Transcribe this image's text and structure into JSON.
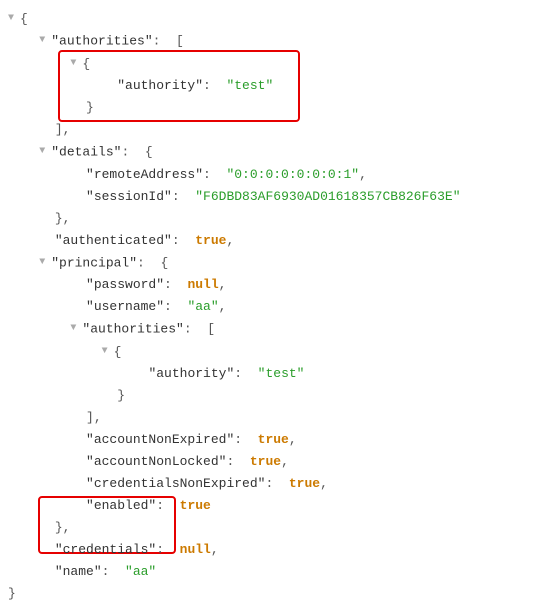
{
  "lines": {
    "l0": "{",
    "k1": "\"authorities\"",
    "v1": "[",
    "l2": "{",
    "k3": "\"authority\"",
    "v3": "\"test\"",
    "l4": "}",
    "l5": "],",
    "k6": "\"details\"",
    "v6": "{",
    "k7": "\"remoteAddress\"",
    "v7": "\"0:0:0:0:0:0:0:1\"",
    "k8": "\"sessionId\"",
    "v8": "\"F6DBD83AF6930AD01618357CB826F63E\"",
    "l9": "},",
    "k10": "\"authenticated\"",
    "v10": "true",
    "k11": "\"principal\"",
    "v11": "{",
    "k12": "\"password\"",
    "v12": "null",
    "k13": "\"username\"",
    "v13": "\"aa\"",
    "k14": "\"authorities\"",
    "v14": "[",
    "l15": "{",
    "k16": "\"authority\"",
    "v16": "\"test\"",
    "l17": "}",
    "l18": "],",
    "k19": "\"accountNonExpired\"",
    "v19": "true",
    "k20": "\"accountNonLocked\"",
    "v20": "true",
    "k21": "\"credentialsNonExpired\"",
    "v21": "true",
    "k22": "\"enabled\"",
    "v22": "true",
    "l23": "},",
    "k24": "\"credentials\"",
    "v24": "null",
    "k25": "\"name\"",
    "v25": "\"aa\"",
    "l26": "}"
  }
}
